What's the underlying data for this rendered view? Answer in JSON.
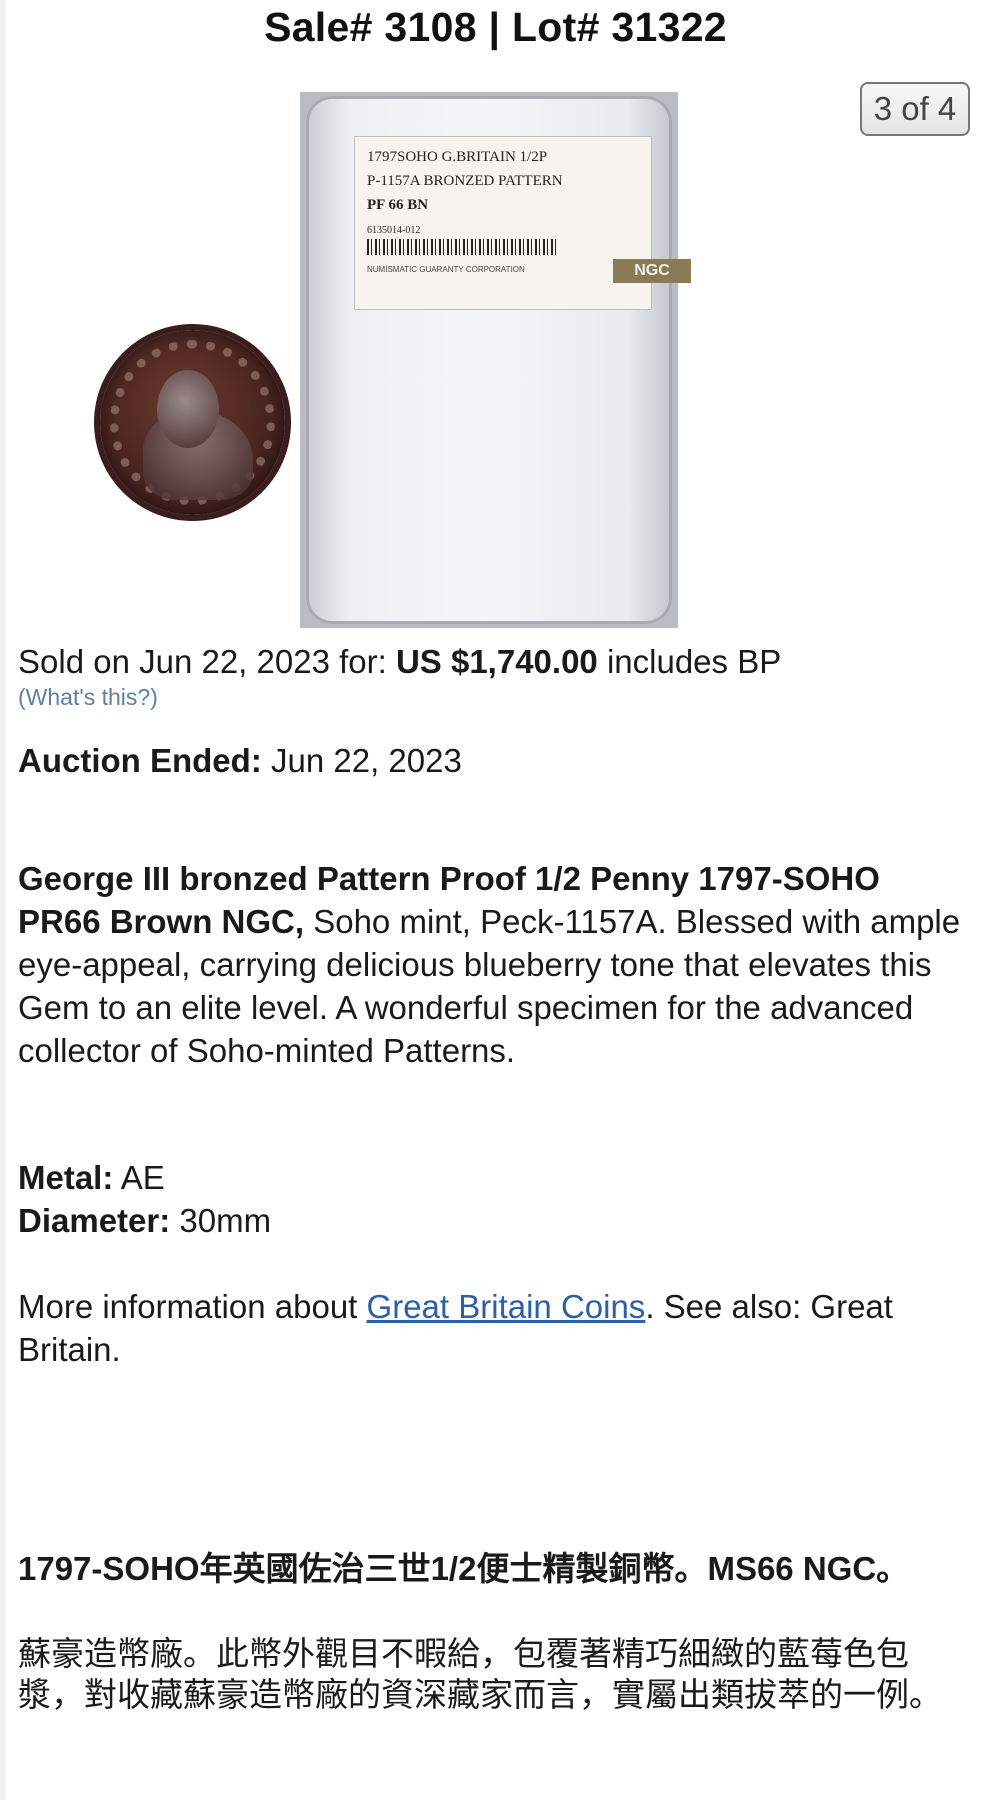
{
  "header": {
    "sale_title": "Sale# 3108 | Lot# 31322",
    "image_counter": "3 of 4"
  },
  "slab_label": {
    "line1": "1797SOHO G.BRITAIN 1/2P",
    "line2": "P-1157A BRONZED PATTERN",
    "grade": "PF 66 BN",
    "cert_number": "6135014-012",
    "grader": "NUMISMATIC GUARANTY CORPORATION",
    "logo": "NGC"
  },
  "sale": {
    "sold_prefix": "Sold on Jun 22, 2023 for:",
    "price": "US $1,740.00",
    "sold_suffix": "includes BP",
    "whats_this": "(What's this?)",
    "ended_label": "Auction Ended:",
    "ended_date": "Jun 22, 2023"
  },
  "description": {
    "title_bold": "George III bronzed Pattern Proof 1/2 Penny 1797-SOHO PR66 Brown NGC,",
    "body": "Soho mint, Peck-1157A. Blessed with ample eye-appeal, carrying delicious blueberry tone that elevates this Gem to an elite level. A wonderful specimen for the advanced collector of Soho-minted Patterns."
  },
  "specs": {
    "metal_label": "Metal:",
    "metal_value": "AE",
    "diameter_label": "Diameter:",
    "diameter_value": "30mm"
  },
  "more_info": {
    "prefix": "More information about",
    "link_text": "Great Britain Coins",
    "suffix": ". See also: Great Britain."
  },
  "chinese": {
    "title": "1797-SOHO年英國佐治三世1/2便士精製銅幣。MS66 NGC。",
    "body": "蘇豪造幣廠。此幣外觀目不暇給，包覆著精巧細緻的藍莓色包漿，對收藏蘇豪造幣廠的資深藏家而言，實屬出類拔萃的一例。"
  },
  "colors": {
    "link": "#2b5fa8",
    "whats_this": "#5d7fa6",
    "text": "#1a1a1a"
  }
}
